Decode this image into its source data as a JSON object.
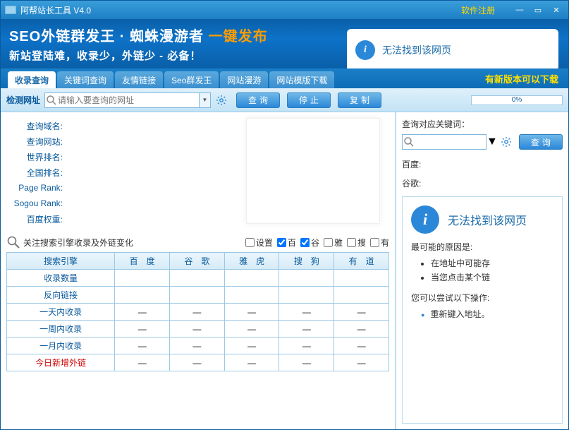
{
  "titlebar": {
    "title": "阿帮站长工具 V4.0",
    "register": "软件注册"
  },
  "banner": {
    "h1_a": "SEO外链群发王 · 蜘蛛漫游者",
    "h1_b": "一键发布",
    "sub": "新站登陆难，收录少，外链少 - 必备！",
    "card_text": "无法找到该网页"
  },
  "tabs": {
    "items": [
      {
        "label": "收录查询",
        "active": true
      },
      {
        "label": "关键词查询",
        "active": false
      },
      {
        "label": "友情链接",
        "active": false
      },
      {
        "label": "Seo群发王",
        "active": false
      },
      {
        "label": "网站漫游",
        "active": false
      },
      {
        "label": "网站模版下载",
        "active": false
      }
    ],
    "notice": "有新版本可以下载"
  },
  "toolbar": {
    "label": "检测网址",
    "placeholder": "请输入要查询的网址",
    "btn_query": "查询",
    "btn_stop": "停止",
    "btn_copy": "复制",
    "progress": "0%"
  },
  "info": {
    "rows": [
      "查询域名:",
      "查询网站:",
      "世界排名:",
      "全国排名:",
      "Page Rank:",
      "Sogou Rank:",
      "百度权重:"
    ]
  },
  "filter": {
    "text": "关注搜索引擎收录及外链变化",
    "opts": [
      "设置",
      "百",
      "谷",
      "雅",
      "搜",
      "有"
    ],
    "checked": [
      false,
      true,
      true,
      false,
      false,
      false
    ]
  },
  "grid": {
    "col0": "搜索引擎",
    "cols": [
      "百　度",
      "谷　歌",
      "雅　虎",
      "搜　狗",
      "有　道"
    ],
    "rows": [
      {
        "h": "收录数量",
        "v": [
          "",
          "",
          "",
          "",
          ""
        ]
      },
      {
        "h": "反向链接",
        "v": [
          "",
          "",
          "",
          "",
          ""
        ]
      },
      {
        "h": "一天内收录",
        "v": [
          "—",
          "—",
          "—",
          "—",
          "—"
        ]
      },
      {
        "h": "一周内收录",
        "v": [
          "—",
          "—",
          "—",
          "—",
          "—"
        ]
      },
      {
        "h": "一月内收录",
        "v": [
          "—",
          "—",
          "—",
          "—",
          "—"
        ]
      },
      {
        "h": "今日新增外链",
        "v": [
          "—",
          "—",
          "—",
          "—",
          "—"
        ],
        "red": true
      }
    ]
  },
  "right": {
    "label": "查询对应关键词：",
    "btn_query": "查询",
    "engines": [
      "百度:",
      "谷歌:"
    ],
    "panel": {
      "title": "无法找到该网页",
      "reason_h": "最可能的原因是:",
      "reasons": [
        "在地址中可能存",
        "当您点击某个链"
      ],
      "try_h": "您可以尝试以下操作:",
      "try_items": [
        "重新键入地址。"
      ]
    }
  }
}
